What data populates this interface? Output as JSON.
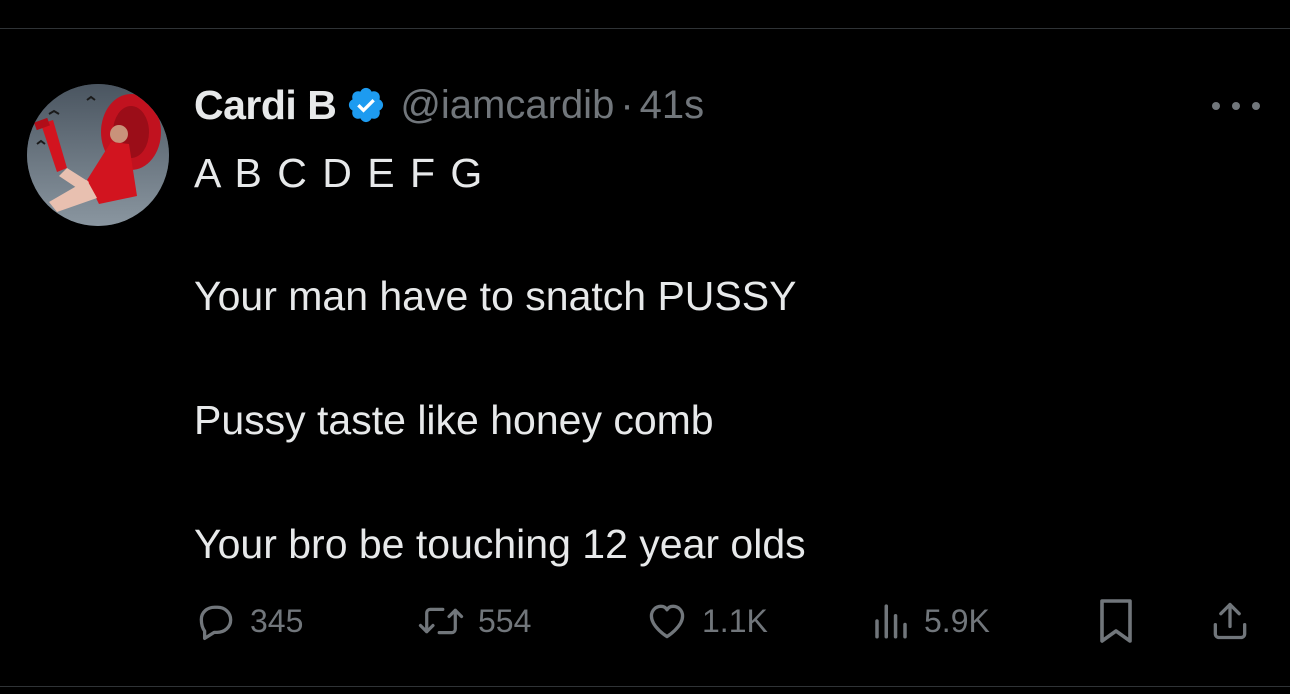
{
  "tweet": {
    "author_name": "Cardi B",
    "handle": "@iamcardib",
    "separator": "·",
    "time": "41s",
    "verified": true,
    "lines": [
      "A B C D E F G",
      "Your man have to snatch PUSSY",
      "Pussy taste like honey comb",
      "Your bro be touching 12 year olds"
    ]
  },
  "actions": {
    "reply_count": "345",
    "retweet_count": "554",
    "like_count": "1.1K",
    "views_count": "5.9K"
  },
  "icons": {
    "verified": "verified-badge-icon",
    "more": "more-options-icon",
    "reply": "reply-icon",
    "retweet": "retweet-icon",
    "like": "heart-icon",
    "views": "views-chart-icon",
    "bookmark": "bookmark-icon",
    "share": "share-icon"
  },
  "colors": {
    "background": "#000000",
    "text": "#e7e9ea",
    "secondary": "#71767b",
    "verified": "#1d9bf0",
    "divider": "#2f3336"
  }
}
